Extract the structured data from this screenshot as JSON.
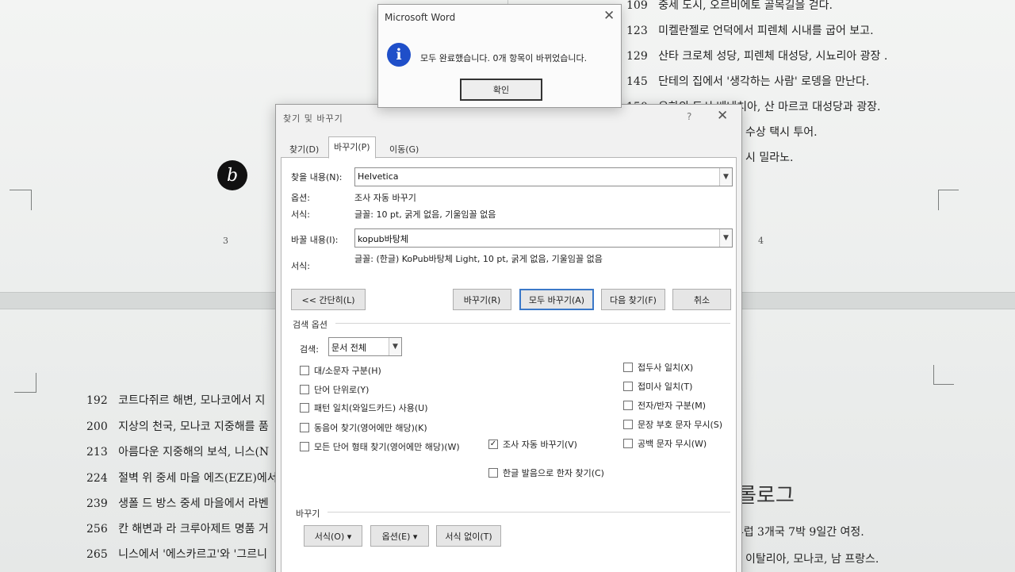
{
  "document": {
    "top_right_lines": [
      {
        "num": "109",
        "text": "중세 도시, 오르비에토 골목길을 걷다."
      },
      {
        "num": "123",
        "text": "미켈란젤로 언덕에서 피렌체 시내를 굽어 보고."
      },
      {
        "num": "129",
        "text": "산타 크로체 성당, 피렌체 대성당, 시뇨리아 광장 ."
      },
      {
        "num": "145",
        "text": "단테의 집에서 '생각하는 사람' 로뎅을 만난다."
      },
      {
        "num": "150",
        "text": "우하의 도시 베네치아, 산 마르코 대성당과 광장."
      },
      {
        "num": "",
        "text": "수상 택시 투어."
      },
      {
        "num": "",
        "text": "시 밀라노."
      }
    ],
    "page_numbers": {
      "left": "3",
      "right": "4"
    },
    "bottom_left_lines": [
      {
        "num": "192",
        "text": "코트다쥐르 해변, 모나코에서 지"
      },
      {
        "num": "200",
        "text": "지상의 천국, 모나코 지중해를 품"
      },
      {
        "num": "213",
        "text": "아름다운 지중해의 보석, 니스(N"
      },
      {
        "num": "224",
        "text": "절벽 위 중세 마을 에즈(EZE)에서"
      },
      {
        "num": "239",
        "text": "생폴 드 방스 중세 마을에서 라벤"
      },
      {
        "num": "256",
        "text": "칸 해변과 라 크루아제트 명품 거"
      },
      {
        "num": "265",
        "text": "니스에서 '에스카르고'와 '그르니"
      }
    ],
    "bottom_right": {
      "heading": "롤로그",
      "lines": [
        "-럽 3개국 7박 9일간 여정.",
        "이탈리아, 모나코, 남 프랑스."
      ]
    },
    "cursor_badge": "b"
  },
  "find_replace": {
    "title": "찾기 및 바꾸기",
    "help": "?",
    "close": "✕",
    "tabs": [
      {
        "label": "찾기(D)",
        "active": false
      },
      {
        "label": "바꾸기(P)",
        "active": true
      },
      {
        "label": "이동(G)",
        "active": false
      }
    ],
    "find": {
      "label": "찾을 내용(N):",
      "value": "Helvetica",
      "options_label": "옵션:",
      "options_value": "조사 자동 바꾸기",
      "format_label": "서식:",
      "format_value": "글꼴: 10 pt, 굵게 없음, 기울임꼴 없음"
    },
    "replace": {
      "label": "바꿀 내용(I):",
      "value": "kopub바탕체",
      "format_label": "서식:",
      "format_value": "글꼴: (한글) KoPub바탕체 Light, 10 pt, 굵게 없음, 기울임꼴 없음"
    },
    "buttons": {
      "less": "<< 간단히(L)",
      "replace": "바꾸기(R)",
      "replace_all": "모두 바꾸기(A)",
      "find_next": "다음 찾기(F)",
      "cancel": "취소"
    },
    "search_options": {
      "title": "검색 옵션",
      "search_label": "검색:",
      "search_value": "문서 전체",
      "left_checks": [
        {
          "label": "대/소문자 구분(H)",
          "checked": false
        },
        {
          "label": "단어 단위로(Y)",
          "checked": false
        },
        {
          "label": "패턴 일치(와일드카드) 사용(U)",
          "checked": false
        },
        {
          "label": "동음어 찾기(영어에만 해당)(K)",
          "checked": false
        },
        {
          "label": "모든 단어 형태 찾기(영어에만 해당)(W)",
          "checked": false
        }
      ],
      "middle_check": {
        "label": "조사 자동 바꾸기(V)",
        "checked": true
      },
      "hanja_check": {
        "label": "한글 발음으로 한자 찾기(C)",
        "checked": false
      },
      "right_checks": [
        {
          "label": "접두사 일치(X)",
          "checked": false
        },
        {
          "label": "접미사 일치(T)",
          "checked": false
        },
        {
          "label": "전자/반자 구분(M)",
          "checked": false
        },
        {
          "label": "문장 부호 문자 무시(S)",
          "checked": false
        },
        {
          "label": "공백 문자 무시(W)",
          "checked": false
        }
      ]
    },
    "replace_section": {
      "title": "바꾸기",
      "format_btn": "서식(O) ▾",
      "special_btn": "옵션(E) ▾",
      "no_format_btn": "서식 없이(T)"
    }
  },
  "message_box": {
    "title": "Microsoft Word",
    "close": "✕",
    "icon": "i",
    "text": "모두 완료했습니다. 0개 항목이 바뀌었습니다.",
    "ok": "확인"
  }
}
